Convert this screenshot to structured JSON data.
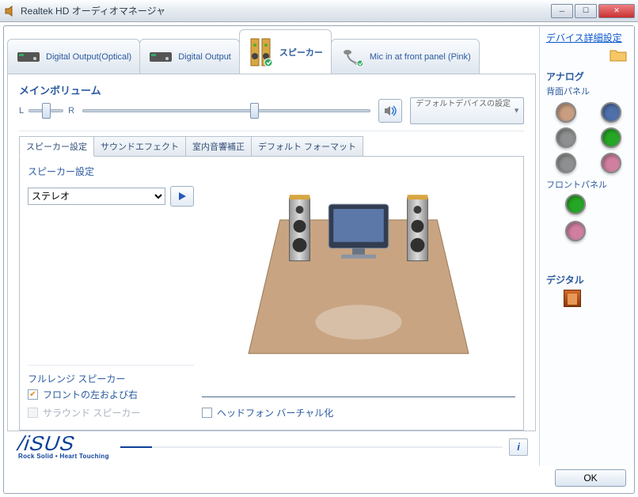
{
  "window": {
    "title": "Realtek HD オーディオマネージャ"
  },
  "deviceTabs": {
    "digitalOptical": "Digital Output(Optical)",
    "digital": "Digital Output",
    "speakers": "スピーカー",
    "micFront": "Mic in at front panel (Pink)"
  },
  "mainVolume": {
    "label": "メインボリューム",
    "L": "L",
    "R": "R",
    "balance": 50,
    "level": 60
  },
  "defaultDevice": {
    "label": "デフォルトデバイスの設定"
  },
  "subTabs": {
    "speakerConfig": "スピーカー設定",
    "soundEffects": "サウンドエフェクト",
    "roomCorrection": "室内音響補正",
    "defaultFormat": "デフォルト フォーマット"
  },
  "speakerConfig": {
    "label": "スピーカー設定",
    "selected": "ステレオ",
    "options": [
      "ステレオ"
    ]
  },
  "fullRange": {
    "title": "フルレンジ スピーカー",
    "frontLR": "フロントの左および右",
    "surround": "サラウンド スピーカー"
  },
  "virtualization": {
    "label": "ヘッドフォン バーチャル化"
  },
  "rightPanel": {
    "advanced": "デバイス詳細設定",
    "analog": "アナログ",
    "rear": "背面パネル",
    "front": "フロントパネル",
    "digital": "デジタル"
  },
  "jackColors": {
    "rear": [
      "#c99d80",
      "#4e6fa8",
      "#8e8f90",
      "#26a626",
      "#8e8f90",
      "#d07fa0"
    ],
    "front": [
      "#26a626",
      "#d07fa0"
    ]
  },
  "brand": {
    "name": "/iSUS",
    "tagline": "Rock Solid • Heart Touching"
  },
  "ok": "OK"
}
